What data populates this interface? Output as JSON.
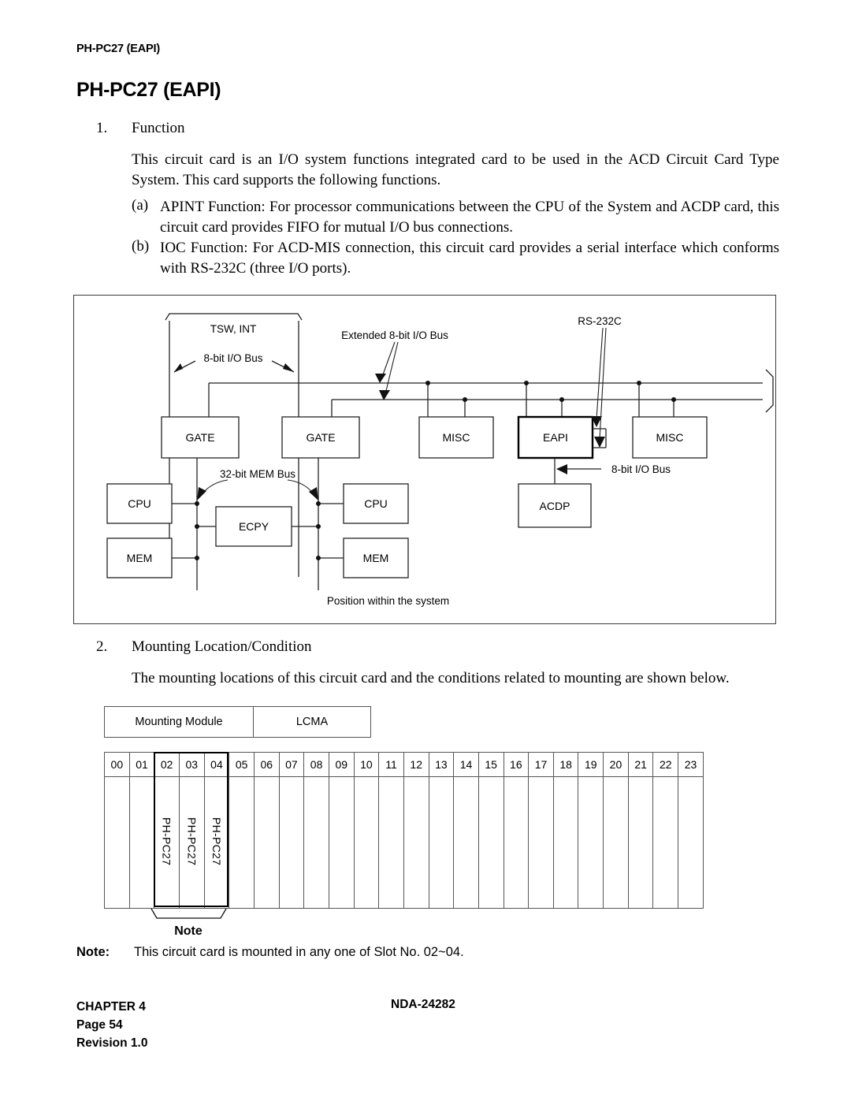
{
  "header": {
    "running_head": "PH-PC27 (EAPI)",
    "title": "PH-PC27 (EAPI)"
  },
  "sections": [
    {
      "number": "1.",
      "title": "Function",
      "paragraph": "This circuit card is an I/O system functions integrated card to be used in the ACD Circuit Card Type System. This card supports the following functions.",
      "items": [
        {
          "marker": "(a)",
          "text": "APINT Function: For processor communications between the CPU of the System and ACDP card, this circuit card provides FIFO for mutual I/O bus connections."
        },
        {
          "marker": "(b)",
          "text": "IOC Function: For ACD-MIS connection, this circuit card provides a serial interface which conforms with RS-232C (three I/O ports)."
        }
      ]
    },
    {
      "number": "2.",
      "title": "Mounting Location/Condition",
      "paragraph": "The mounting locations of this circuit card and the conditions related to mounting are shown below."
    }
  ],
  "figure": {
    "caption": "Position within the system",
    "brace_label": "TSW, INT",
    "annotations": {
      "bus_8bit_top": "8-bit I/O Bus",
      "bus_extended": "Extended 8-bit I/O Bus",
      "rs232c": "RS-232C",
      "bus_8bit_acdp": "8-bit I/O Bus",
      "mem_bus": "32-bit MEM Bus"
    },
    "blocks": {
      "gate1": "GATE",
      "gate2": "GATE",
      "misc1": "MISC",
      "eapi": "EAPI",
      "misc2": "MISC",
      "cpu1": "CPU",
      "cpu2": "CPU",
      "mem1": "MEM",
      "mem2": "MEM",
      "ecpy": "ECPY",
      "acdp": "ACDP"
    }
  },
  "mounting_module": {
    "label": "Mounting Module",
    "value": "LCMA"
  },
  "slots": {
    "numbers": [
      "00",
      "01",
      "02",
      "03",
      "04",
      "05",
      "06",
      "07",
      "08",
      "09",
      "10",
      "11",
      "12",
      "13",
      "14",
      "15",
      "16",
      "17",
      "18",
      "19",
      "20",
      "21",
      "22",
      "23"
    ],
    "cards": [
      "",
      "",
      "PH-PC27",
      "PH-PC27",
      "PH-PC27",
      "",
      "",
      "",
      "",
      "",
      "",
      "",
      "",
      "",
      "",
      "",
      "",
      "",
      "",
      "",
      "",
      "",
      "",
      ""
    ],
    "highlight_label": "Note"
  },
  "note": {
    "key": "Note:",
    "text": "This circuit card is mounted in any one of Slot No. 02~04."
  },
  "footer": {
    "chapter": "CHAPTER 4",
    "page": "Page 54",
    "revision": "Revision 1.0",
    "doc_number": "NDA-24282"
  }
}
